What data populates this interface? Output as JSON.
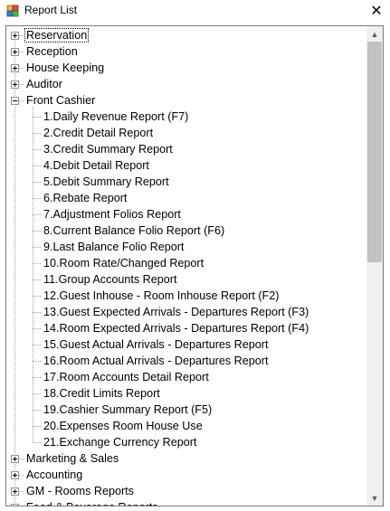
{
  "window": {
    "title": "Report List",
    "close_glyph": "✕",
    "icon": "report-list-app-icon"
  },
  "tree": {
    "nodes": [
      {
        "label": "Reservation",
        "level": 0,
        "expander": "plus",
        "selected": true
      },
      {
        "label": "Reception",
        "level": 0,
        "expander": "plus"
      },
      {
        "label": "House Keeping",
        "level": 0,
        "expander": "plus"
      },
      {
        "label": "Auditor",
        "level": 0,
        "expander": "plus"
      },
      {
        "label": "Front Cashier",
        "level": 0,
        "expander": "minus"
      },
      {
        "label": "1.Daily Revenue Report (F7)",
        "level": 1
      },
      {
        "label": "2.Credit Detail Report",
        "level": 1
      },
      {
        "label": "3.Credit Summary Report",
        "level": 1
      },
      {
        "label": "4.Debit Detail Report",
        "level": 1
      },
      {
        "label": "5.Debit Summary Report",
        "level": 1
      },
      {
        "label": "6.Rebate Report",
        "level": 1
      },
      {
        "label": "7.Adjustment Folios Report",
        "level": 1
      },
      {
        "label": "8.Current Balance Folio Report (F6)",
        "level": 1
      },
      {
        "label": "9.Last Balance Folio Report",
        "level": 1
      },
      {
        "label": "10.Room Rate/Changed Report",
        "level": 1
      },
      {
        "label": "11.Group Accounts Report",
        "level": 1
      },
      {
        "label": "12.Guest Inhouse - Room Inhouse Report (F2)",
        "level": 1
      },
      {
        "label": "13.Guest Expected Arrivals - Departures Report (F3)",
        "level": 1
      },
      {
        "label": "14.Room Expected Arrivals - Departures Report (F4)",
        "level": 1
      },
      {
        "label": "15.Guest Actual Arrivals - Departures Report",
        "level": 1
      },
      {
        "label": "16.Room Actual Arrivals - Departures Report",
        "level": 1
      },
      {
        "label": "17.Room Accounts Detail Report",
        "level": 1
      },
      {
        "label": "18.Credit Limits Report",
        "level": 1
      },
      {
        "label": "19.Cashier Summary Report (F5)",
        "level": 1
      },
      {
        "label": "20.Expenses Room House Use",
        "level": 1
      },
      {
        "label": "21.Exchange Currency Report",
        "level": 1
      },
      {
        "label": "Marketing & Sales",
        "level": 0,
        "expander": "plus"
      },
      {
        "label": "Accounting",
        "level": 0,
        "expander": "plus"
      },
      {
        "label": "GM - Rooms Reports",
        "level": 0,
        "expander": "plus"
      },
      {
        "label": "Food & Beverage Reports",
        "level": 0,
        "expander": "plus"
      }
    ]
  },
  "scrollbar": {
    "up_glyph": "▲",
    "down_glyph": "▼",
    "scroll_fraction": 0.0
  }
}
